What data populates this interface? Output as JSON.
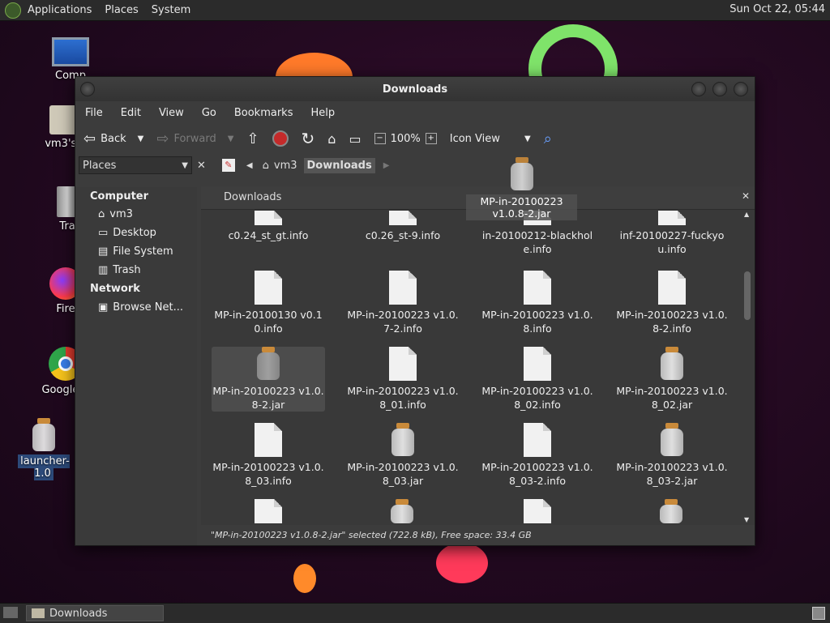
{
  "topbar": {
    "menus": [
      "Applications",
      "Places",
      "System"
    ],
    "clock": "Sun Oct 22, 05:44"
  },
  "desktop_icons": [
    {
      "label": "Comp",
      "icon": "computer-icon"
    },
    {
      "label": "vm3's h",
      "icon": "home-folder-icon"
    },
    {
      "label": "Tra",
      "icon": "trash-icon"
    },
    {
      "label": "Fire",
      "icon": "firefox-icon"
    },
    {
      "label": "Google C",
      "icon": "chrome-icon"
    },
    {
      "label": "launcher-1.0",
      "icon": "jar-icon"
    }
  ],
  "window": {
    "title": "Downloads",
    "menubar": [
      "File",
      "Edit",
      "View",
      "Go",
      "Bookmarks",
      "Help"
    ],
    "toolbar": {
      "back": "Back",
      "forward": "Forward",
      "zoom": "100%",
      "view_mode": "Icon View"
    },
    "location": {
      "places_label": "Places",
      "crumbs": [
        "vm3",
        "Downloads"
      ]
    },
    "sidebar": {
      "computer_header": "Computer",
      "computer_items": [
        "vm3",
        "Desktop",
        "File System",
        "Trash"
      ],
      "network_header": "Network",
      "network_items": [
        "Browse Net..."
      ]
    },
    "tab_title": "Downloads",
    "files": [
      {
        "name": "c0.24_st_gt.info",
        "type": "info"
      },
      {
        "name": "c0.26_st-9.info",
        "type": "info"
      },
      {
        "name": "in-20100212-blackhole.info",
        "type": "info"
      },
      {
        "name": "inf-20100227-fuckyou.info",
        "type": "info"
      },
      {
        "name": "MP-in-20100130 v0.10.info",
        "type": "info"
      },
      {
        "name": "MP-in-20100223 v1.0.7-2.info",
        "type": "info"
      },
      {
        "name": "MP-in-20100223 v1.0.8.info",
        "type": "info"
      },
      {
        "name": "MP-in-20100223 v1.0.8-2.info",
        "type": "info"
      },
      {
        "name": "MP-in-20100223 v1.0.8-2.jar",
        "type": "jar"
      },
      {
        "name": "MP-in-20100223 v1.0.8_01.info",
        "type": "info"
      },
      {
        "name": "MP-in-20100223 v1.0.8_02.info",
        "type": "info"
      },
      {
        "name": "MP-in-20100223 v1.0.8_02.jar",
        "type": "jar"
      },
      {
        "name": "MP-in-20100223 v1.0.8_03.info",
        "type": "info"
      },
      {
        "name": "MP-in-20100223 v1.0.8_03.jar",
        "type": "jar"
      },
      {
        "name": "MP-in-20100223 v1.0.8_03-2.info",
        "type": "info"
      },
      {
        "name": "MP-in-20100223 v1.0.8_03-2.jar",
        "type": "jar"
      }
    ],
    "drag_label": "MP-in-20100223 v1.0.8-2.jar",
    "status": "\"MP-in-20100223 v1.0.8-2.jar\" selected (722.8 kB), Free space: 33.4 GB"
  },
  "taskbar": {
    "task": "Downloads"
  }
}
